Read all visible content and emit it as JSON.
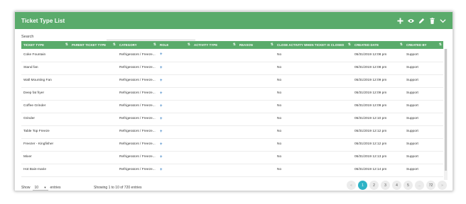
{
  "header": {
    "title": "Ticket Type List",
    "tools": [
      {
        "name": "add-icon"
      },
      {
        "name": "view-icon"
      },
      {
        "name": "edit-icon"
      },
      {
        "name": "delete-icon"
      },
      {
        "name": "chevron-down-icon"
      }
    ]
  },
  "search": {
    "label": "Search",
    "value": ""
  },
  "table": {
    "columns": [
      "TICKET TYPE",
      "PARENT TICKET TYPE",
      "CATEGORY",
      "ROLE",
      "ACTIVITY TYPE",
      "REASON",
      "CLOSE ACTIVITY WHEN TICKET IS CLOSED",
      "CREATED DATE",
      "CREATED BY"
    ],
    "rows": [
      {
        "ticket_type": "Coke Fountain",
        "parent": "",
        "category": "Refrigerators / Freeze...",
        "role": "+",
        "activity": "",
        "reason": "",
        "close": "No",
        "created_date": "05/31/2019 12:08 pm",
        "created_by": "Support"
      },
      {
        "ticket_type": "Stand fan",
        "parent": "",
        "category": "Refrigerators / Freeze...",
        "role": "+",
        "activity": "",
        "reason": "",
        "close": "No",
        "created_date": "05/31/2019 12:08 pm",
        "created_by": "Support"
      },
      {
        "ticket_type": "Wall Mounting Fan",
        "parent": "",
        "category": "Refrigerators / Freeze...",
        "role": "+",
        "activity": "",
        "reason": "",
        "close": "No",
        "created_date": "05/31/2019 12:09 pm",
        "created_by": "Support"
      },
      {
        "ticket_type": "Deep fat fryer",
        "parent": "",
        "category": "Refrigerators / Freeze...",
        "role": "+",
        "activity": "",
        "reason": "",
        "close": "No",
        "created_date": "05/31/2019 12:09 pm",
        "created_by": "Support"
      },
      {
        "ticket_type": "Coffee Grinder",
        "parent": "",
        "category": "Refrigerators / Freeze...",
        "role": "+",
        "activity": "",
        "reason": "",
        "close": "No",
        "created_date": "05/31/2019 12:09 pm",
        "created_by": "Support"
      },
      {
        "ticket_type": "Grinder",
        "parent": "",
        "category": "Refrigerators / Freeze...",
        "role": "+",
        "activity": "",
        "reason": "",
        "close": "No",
        "created_date": "05/31/2019 12:10 pm",
        "created_by": "Support"
      },
      {
        "ticket_type": "Table Top Freeze",
        "parent": "",
        "category": "Refrigerators / Freeze...",
        "role": "+",
        "activity": "",
        "reason": "",
        "close": "No",
        "created_date": "05/31/2019 12:12 pm",
        "created_by": "Support"
      },
      {
        "ticket_type": "Freezer - Kingfisher",
        "parent": "",
        "category": "Refrigerators / Freeze...",
        "role": "+",
        "activity": "",
        "reason": "",
        "close": "No",
        "created_date": "05/31/2019 12:12 pm",
        "created_by": "Support"
      },
      {
        "ticket_type": "Mixer",
        "parent": "",
        "category": "Refrigerators / Freeze...",
        "role": "+",
        "activity": "",
        "reason": "",
        "close": "No",
        "created_date": "05/31/2019 12:13 pm",
        "created_by": "Support"
      },
      {
        "ticket_type": "Hot Bain-marie",
        "parent": "",
        "category": "Refrigerators / Freeze...",
        "role": "+",
        "activity": "",
        "reason": "",
        "close": "No",
        "created_date": "05/31/2019 12:14 pm",
        "created_by": "Support"
      }
    ]
  },
  "footer": {
    "show_label": "Show",
    "page_size": "10",
    "entries_label": "entries",
    "info": "Showing 1 to 10 of 720 entries",
    "pages": [
      "«",
      "1",
      "2",
      "3",
      "4",
      "5",
      "...",
      "72",
      "»"
    ],
    "active_page": "1"
  },
  "colors": {
    "header": "#5aab6b",
    "active_page": "#2fb3c6",
    "role_plus": "#3b82c4"
  }
}
